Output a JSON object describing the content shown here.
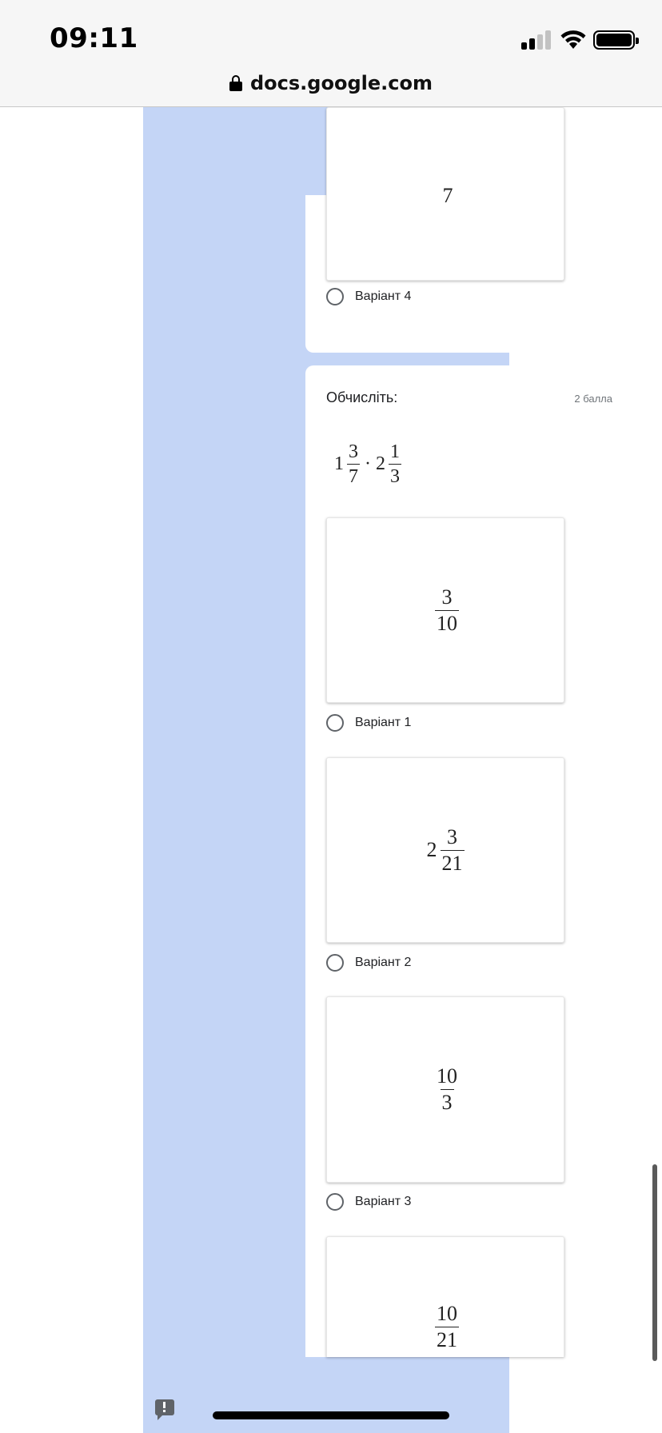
{
  "status_bar": {
    "time": "09:11"
  },
  "browser": {
    "url": "docs.google.com"
  },
  "prev_question": {
    "partial_fraction_den": "7",
    "option4_label": "Варіант 4"
  },
  "question": {
    "title": "Обчисліть:",
    "points": "2 балла",
    "expression": {
      "term1": {
        "whole": "1",
        "num": "3",
        "den": "7"
      },
      "operator": "·",
      "term2": {
        "whole": "2",
        "num": "1",
        "den": "3"
      }
    },
    "options": [
      {
        "label": "Варіант 1",
        "whole": "",
        "num": "3",
        "den": "10"
      },
      {
        "label": "Варіант 2",
        "whole": "2",
        "num": "3",
        "den": "21"
      },
      {
        "label": "Варіант 3",
        "whole": "",
        "num": "10",
        "den": "3"
      },
      {
        "label": "",
        "whole": "",
        "num": "10",
        "den": "21"
      }
    ]
  },
  "icons": {
    "lock": "lock-icon",
    "wifi": "wifi-icon",
    "signal": "cellular-signal-icon",
    "battery": "battery-icon",
    "feedback": "feedback-icon",
    "radio": "radio-button-icon"
  },
  "colors": {
    "form_background": "#c4d5f6",
    "card": "#ffffff",
    "status_bar": "#f6f6f6"
  }
}
